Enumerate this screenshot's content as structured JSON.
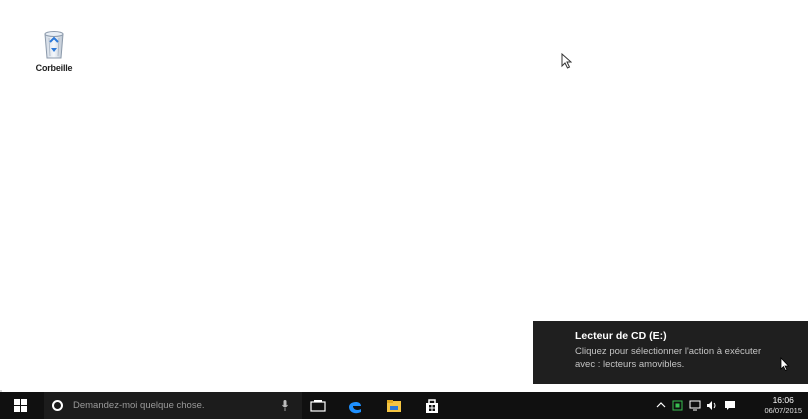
{
  "desktop": {
    "icons": [
      {
        "label": "Corbeille",
        "icon": "recycle-bin-icon"
      }
    ]
  },
  "toast": {
    "title": "Lecteur de CD (E:)",
    "body": "Cliquez pour sélectionner l'action à exécuter avec : lecteurs amovibles."
  },
  "taskbar": {
    "search_placeholder": "Demandez-moi quelque chose.",
    "apps": [
      "task-view-icon",
      "edge-icon",
      "file-explorer-icon",
      "store-icon"
    ],
    "tray_icons": [
      "chevron-up-icon",
      "network-icon",
      "monitor-icon",
      "volume-icon",
      "action-center-icon"
    ],
    "clock": {
      "time": "16:06",
      "date": "06/07/2015"
    }
  },
  "colors": {
    "taskbar": "#101010",
    "toast_background": "#1f1f1f",
    "edge_blue": "#1e90ff",
    "explorer_yellow": "#f4c542"
  }
}
